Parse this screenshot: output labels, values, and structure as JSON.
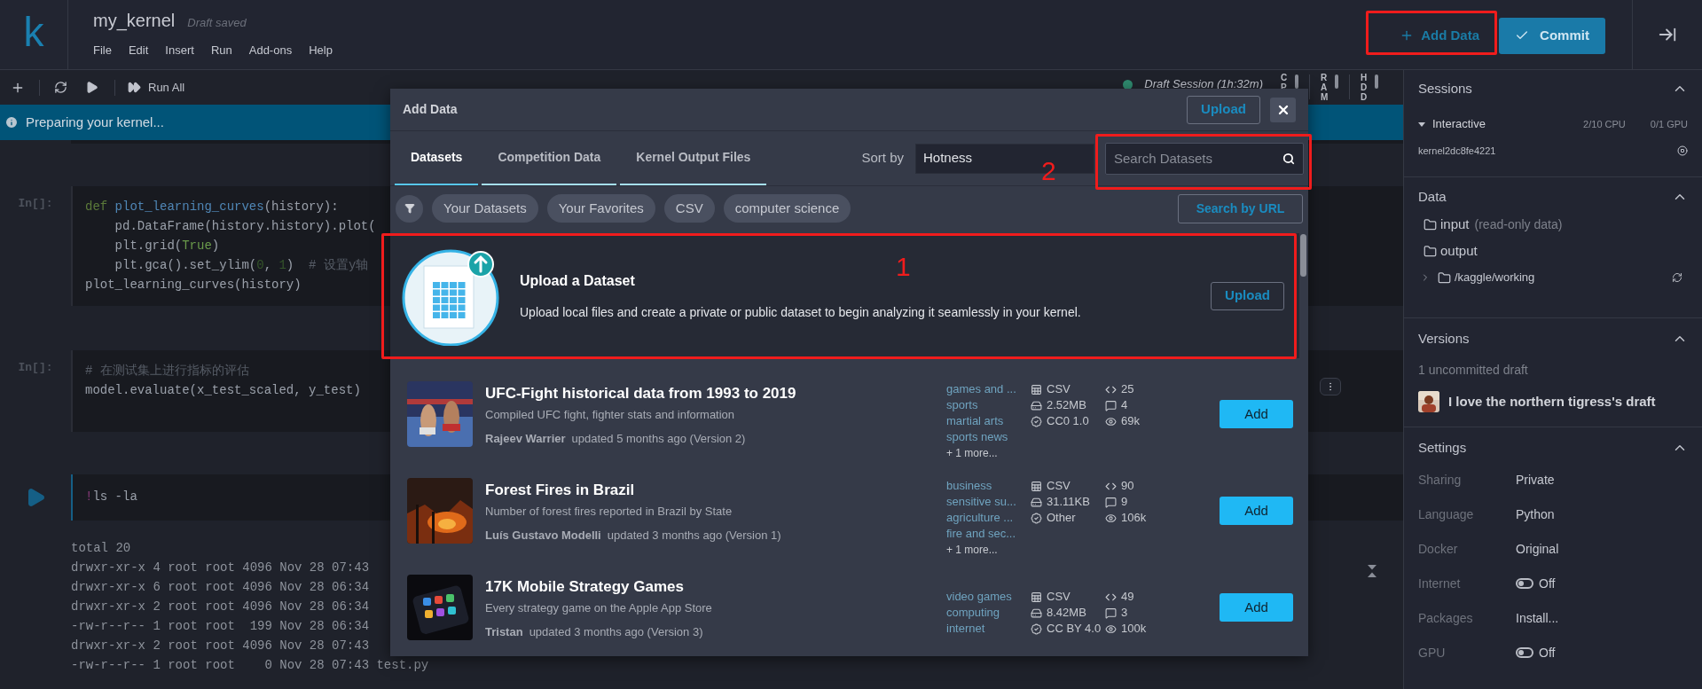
{
  "header": {
    "logo": "k",
    "title": "my_kernel",
    "save_status": "Draft saved",
    "menu": [
      "File",
      "Edit",
      "Insert",
      "Run",
      "Add-ons",
      "Help"
    ],
    "add_data": "Add Data",
    "commit": "Commit"
  },
  "toolbar": {
    "run_all": "Run All",
    "session": "Draft Session (1h:32m)",
    "meters": [
      {
        "label": "CP"
      },
      {
        "label": "RAM"
      },
      {
        "label": "HDD"
      }
    ]
  },
  "banner": "Preparing your kernel...",
  "cells": [
    {
      "kind": "code",
      "prompt": "In[]:",
      "lines": [
        [
          {
            "text": "def",
            "kind": "keyword"
          },
          {
            "text": " plot_learning_curves",
            "kind": "function"
          },
          {
            "text": "(history):",
            "kind": "plain"
          }
        ],
        [
          {
            "text": "    pd.DataFrame(history.history).plot(",
            "kind": "plain"
          }
        ],
        [
          {
            "text": "    plt.grid(",
            "kind": "plain"
          },
          {
            "text": "True",
            "kind": "literal"
          },
          {
            "text": ")",
            "kind": "plain"
          }
        ],
        [
          {
            "text": "    plt.gca().set_ylim(",
            "kind": "plain"
          },
          {
            "text": "0",
            "kind": "number"
          },
          {
            "text": ", ",
            "kind": "plain"
          },
          {
            "text": "1",
            "kind": "number"
          },
          {
            "text": ")  ",
            "kind": "plain"
          },
          {
            "text": "# 设置y轴",
            "kind": "comment"
          }
        ],
        [
          {
            "text": "plot_learning_curves(history)",
            "kind": "plain"
          }
        ]
      ]
    },
    {
      "kind": "code",
      "prompt": "In[]:",
      "lines": [
        [
          {
            "text": "# 在测试集上进行指标的评估",
            "kind": "comment"
          }
        ],
        [
          {
            "text": "model.evaluate(x_test_scaled, y_test)",
            "kind": "plain"
          }
        ]
      ]
    },
    {
      "kind": "running",
      "lines": [
        [
          {
            "text": "!",
            "kind": "bang"
          },
          {
            "text": "ls -la",
            "kind": "plain"
          }
        ]
      ],
      "output": [
        "total 20",
        "drwxr-xr-x 4 root root 4096 Nov 28 07:43",
        "drwxr-xr-x 6 root root 4096 Nov 28 06:34",
        "drwxr-xr-x 2 root root 4096 Nov 28 06:34",
        "-rw-r--r-- 1 root root  199 Nov 28 06:34",
        "drwxr-xr-x 2 root root 4096 Nov 28 07:43",
        "-rw-r--r-- 1 root root    0 Nov 28 07:43 test.py"
      ]
    }
  ],
  "modal": {
    "title": "Add Data",
    "upload": "Upload",
    "tabs": [
      {
        "label": "Datasets",
        "selected": true
      },
      {
        "label": "Competition Data",
        "selected": false
      },
      {
        "label": "Kernel Output Files",
        "selected": false
      }
    ],
    "sort_label": "Sort by",
    "sort_value": "Hotness",
    "search_placeholder": "Search Datasets",
    "chips": [
      "Your Datasets",
      "Your Favorites",
      "CSV",
      "computer science"
    ],
    "search_url": "Search by URL",
    "upload_card": {
      "title": "Upload a Dataset",
      "description": "Upload local files and create a private or public dataset to begin analyzing it seamlessly in your kernel.",
      "button": "Upload"
    },
    "datasets": [
      {
        "title": "UFC-Fight historical data from 1993 to 2019",
        "subtitle": "Compiled UFC fight, fighter stats and information",
        "author": "Rajeev Warrier",
        "updated": "updated 5 months ago (Version 2)",
        "tags": [
          "games and ...",
          "sports",
          "martial arts",
          "sports news"
        ],
        "more": "+ 1 more...",
        "file_type": "CSV",
        "size": "2.52MB",
        "license": "CC0 1.0",
        "kernels": "25",
        "comments": "4",
        "views": "69k",
        "add": "Add"
      },
      {
        "title": "Forest Fires in Brazil",
        "subtitle": "Number of forest fires reported in Brazil by State",
        "author": "Luís Gustavo Modelli",
        "updated": "updated 3 months ago (Version 1)",
        "tags": [
          "business",
          "sensitive su...",
          "agriculture ...",
          "fire and sec..."
        ],
        "more": "+ 1 more...",
        "file_type": "CSV",
        "size": "31.11KB",
        "license": "Other",
        "kernels": "90",
        "comments": "9",
        "views": "106k",
        "add": "Add"
      },
      {
        "title": "17K Mobile Strategy Games",
        "subtitle": "Every strategy game on the Apple App Store",
        "author": "Tristan",
        "updated": "updated 3 months ago (Version 3)",
        "tags": [
          "video games",
          "computing",
          "internet"
        ],
        "file_type": "CSV",
        "size": "8.42MB",
        "license": "CC BY 4.0",
        "kernels": "49",
        "comments": "3",
        "views": "100k",
        "add": "Add"
      }
    ]
  },
  "sidebar": {
    "sessions": {
      "title": "Sessions",
      "name": "Interactive",
      "cpu": "2/10 CPU",
      "gpu": "0/1 GPU",
      "kernel": "kernel2dc8fe4221"
    },
    "data": {
      "title": "Data",
      "items": [
        {
          "name": "input",
          "note": "(read-only data)"
        },
        {
          "name": "output"
        },
        {
          "name": "/kaggle/working",
          "expandable": true
        }
      ]
    },
    "versions": {
      "title": "Versions",
      "count": "1 uncommitted draft",
      "draft": "I love the northern tigress's draft"
    },
    "settings": {
      "title": "Settings",
      "rows": [
        {
          "label": "Sharing",
          "value": "Private",
          "kind": "text"
        },
        {
          "label": "Language",
          "value": "Python",
          "kind": "text"
        },
        {
          "label": "Docker",
          "value": "Original",
          "kind": "text"
        },
        {
          "label": "Internet",
          "value": "Off",
          "kind": "toggle",
          "on": false
        },
        {
          "label": "Packages",
          "value": "Install...",
          "kind": "text"
        },
        {
          "label": "GPU",
          "value": "Off",
          "kind": "toggle",
          "on": false
        }
      ]
    }
  },
  "annotations": [
    {
      "label": "1"
    },
    {
      "label": "2"
    }
  ]
}
